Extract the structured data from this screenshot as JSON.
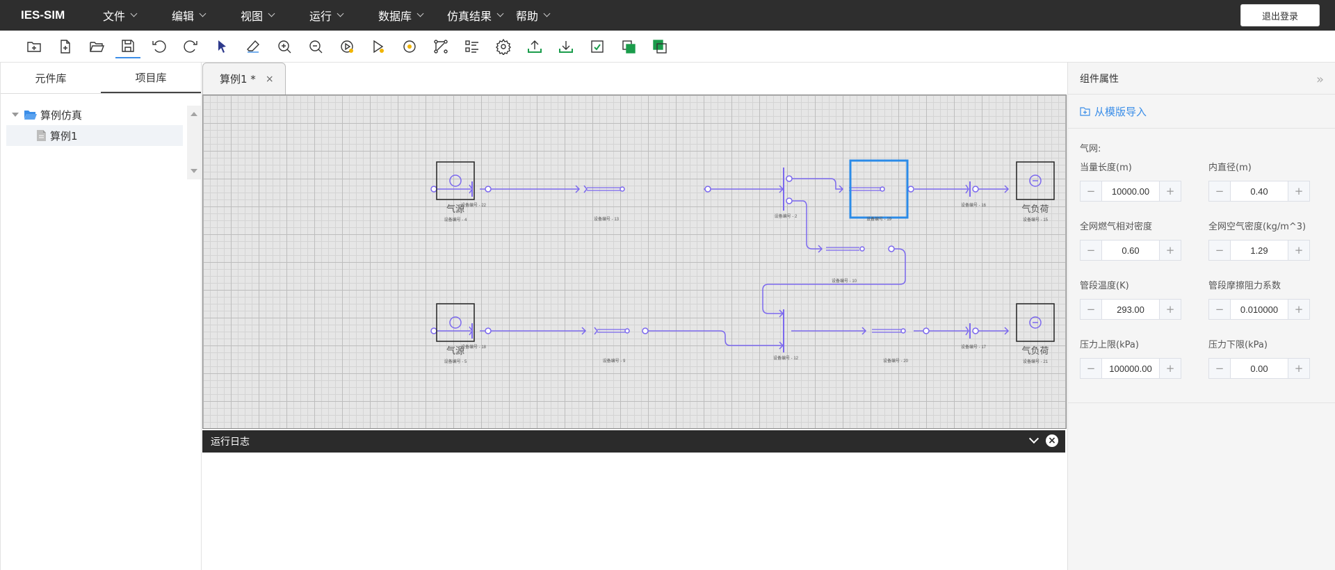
{
  "app": {
    "logo": "IES-SIM",
    "logout_label": "退出登录"
  },
  "menu": [
    "文件",
    "编辑",
    "视图",
    "运行",
    "数据库",
    "仿真结果",
    "帮助"
  ],
  "toolbar": {
    "tools": [
      "new-folder-icon",
      "new-file-icon",
      "open-folder-icon",
      "save-icon",
      "undo-icon",
      "redo-icon",
      "select-pointer-icon",
      "eraser-icon",
      "zoom-in-icon",
      "zoom-out-icon",
      "play-icon",
      "run-config-icon",
      "target-icon",
      "network-icon",
      "checklist-icon",
      "settings-icon",
      "upload-icon",
      "download-icon",
      "report-icon",
      "copy-icon",
      "layers-icon"
    ],
    "active_tool": "save-icon"
  },
  "left_panel": {
    "tabs": [
      "元件库",
      "项目库"
    ],
    "active_tab": "项目库",
    "tree": {
      "root": "算例仿真",
      "children": [
        "算例1"
      ]
    }
  },
  "editor": {
    "tab_label": "算例1 *",
    "close_label": "×"
  },
  "diagram": {
    "line_color": "#7b68ee",
    "select_color": "#2b8be8",
    "sources": [
      {
        "label": "气源",
        "id": "设备编号 - 4"
      },
      {
        "label": "气源",
        "id": "设备编号 - 5"
      }
    ],
    "loads": [
      {
        "label": "气负荷",
        "id": "设备编号 - 15"
      },
      {
        "label": "气负荷",
        "id": "设备编号 - 21"
      }
    ],
    "device_ids": {
      "n22": "设备编号 - 22",
      "n13": "设备编号 - 13",
      "n2": "设备编号 - 2",
      "n19": "设备编号 - 19",
      "n16": "设备编号 - 16",
      "n10": "设备编号 - 10",
      "n18": "设备编号 - 18",
      "n9": "设备编号 - 9",
      "n12": "设备编号 - 12",
      "n20": "设备编号 - 20",
      "n17": "设备编号 - 17"
    }
  },
  "log": {
    "title": "运行日志"
  },
  "properties": {
    "header": "组件属性",
    "import_label": "从模版导入",
    "section_title": "气网:",
    "fields": [
      {
        "label": "当量长度(m)",
        "value": "10000.00"
      },
      {
        "label": "内直径(m)",
        "value": "0.40"
      },
      {
        "label": "全网燃气相对密度",
        "value": "0.60"
      },
      {
        "label": "全网空气密度(kg/m^3)",
        "value": "1.29"
      },
      {
        "label": "管段温度(K)",
        "value": "293.00"
      },
      {
        "label": "管段摩擦阻力系数",
        "value": "0.010000"
      },
      {
        "label": "压力上限(kPa)",
        "value": "100000.00"
      },
      {
        "label": "压力下限(kPa)",
        "value": "0.00"
      }
    ],
    "minus": "−",
    "plus": "+"
  }
}
